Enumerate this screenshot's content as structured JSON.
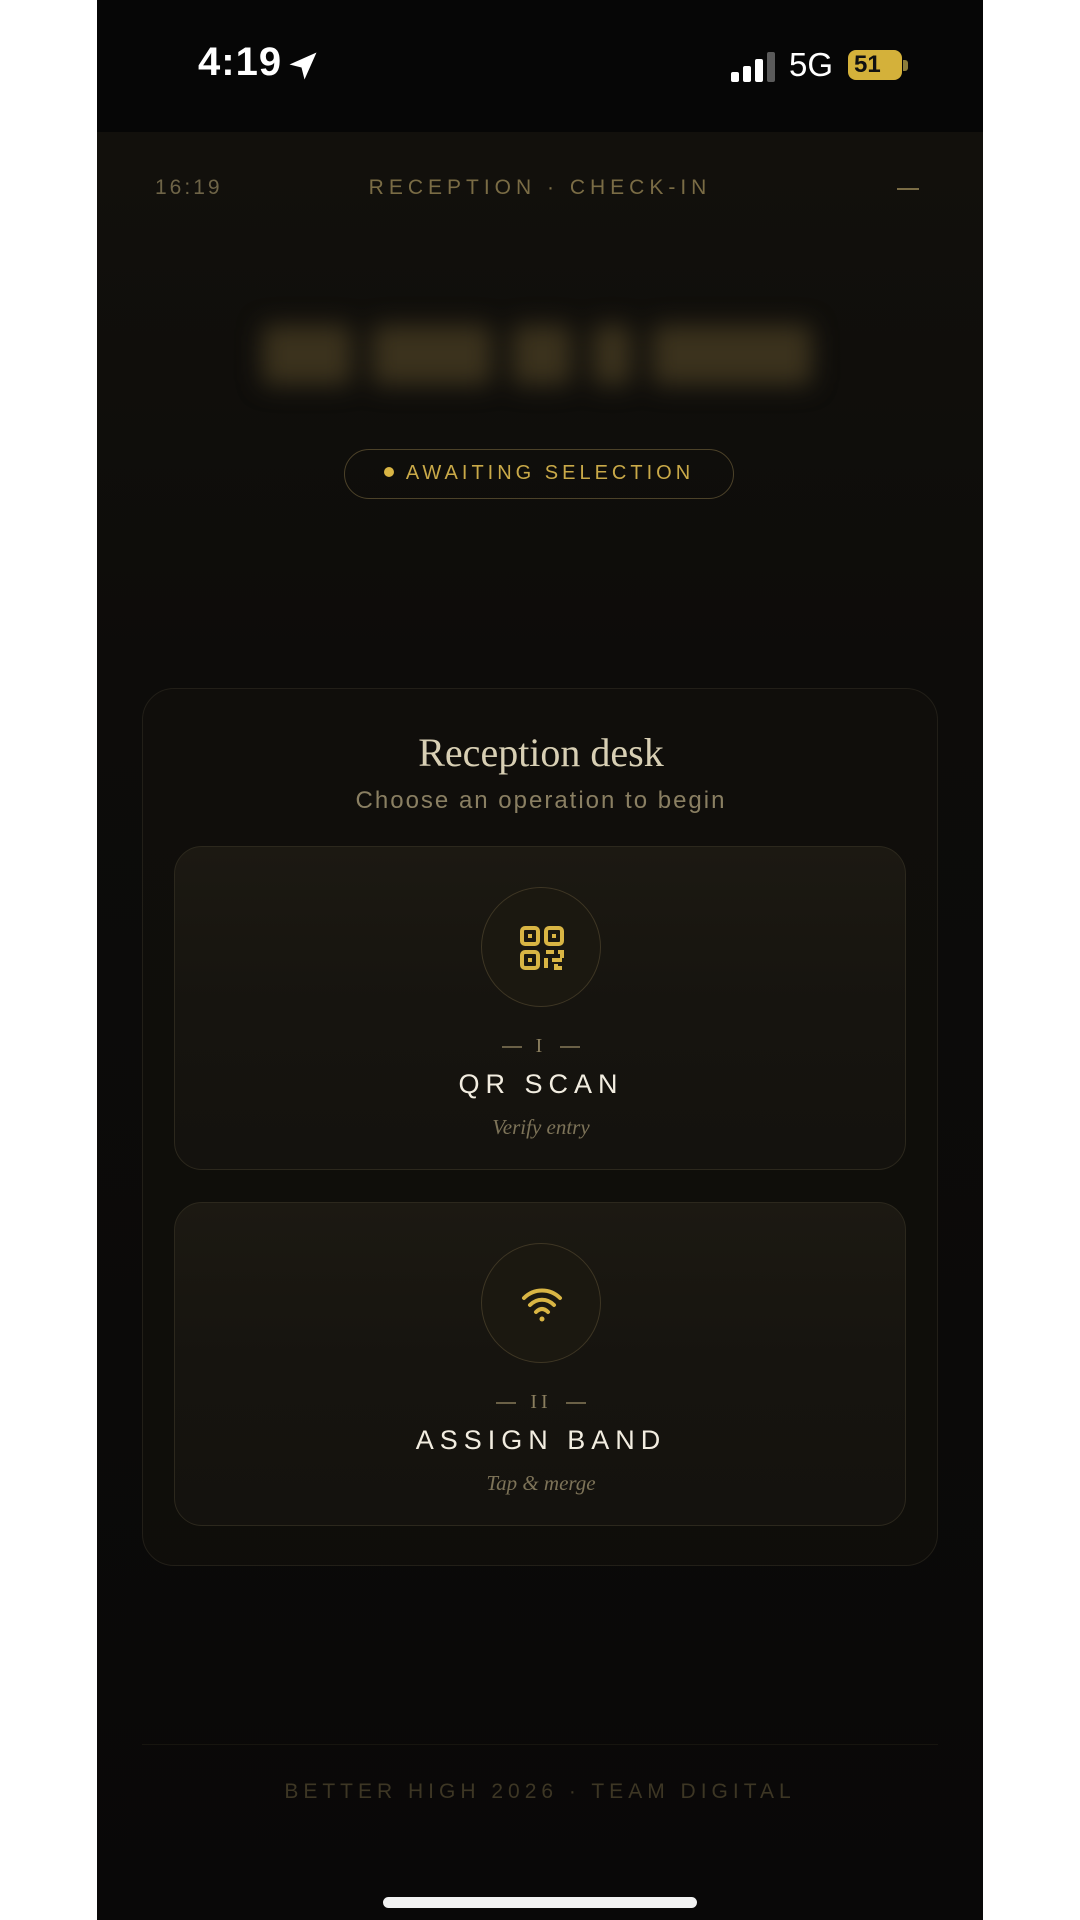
{
  "status_bar": {
    "time": "4:19",
    "network": "5G",
    "battery": "51"
  },
  "header": {
    "clock": "16:19",
    "title": "RECEPTION · CHECK-IN"
  },
  "status_pill": {
    "label": "AWAITING SELECTION"
  },
  "panel": {
    "title": "Reception desk",
    "subtitle": "Choose an operation to begin"
  },
  "operations": [
    {
      "numeral": "I",
      "label": "QR SCAN",
      "hint": "Verify entry",
      "icon": "qr-code-icon"
    },
    {
      "numeral": "II",
      "label": "ASSIGN BAND",
      "hint": "Tap & merge",
      "icon": "wireless-icon"
    }
  ],
  "footer": {
    "text": "BETTER HIGH 2026 · TEAM DIGITAL"
  },
  "colors": {
    "accent": "#d9b544",
    "background": "#0a0908",
    "text_primary": "#f2ede0"
  }
}
